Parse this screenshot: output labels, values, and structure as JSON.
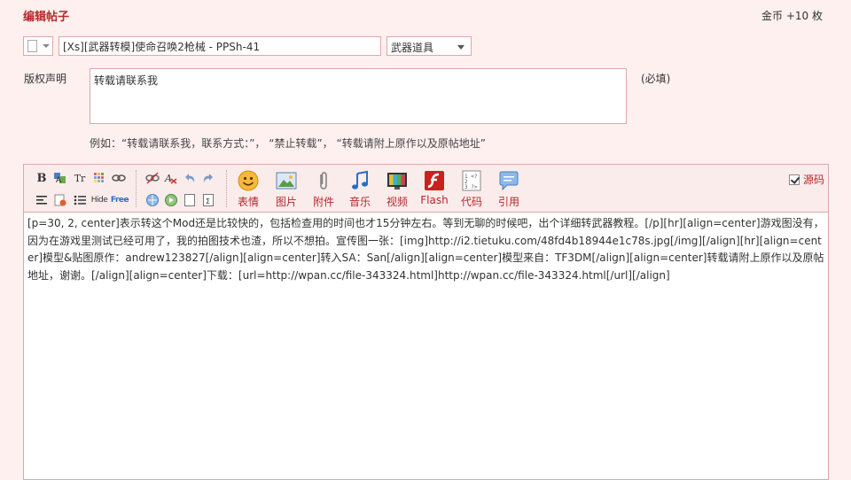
{
  "page": {
    "title": "编辑帖子",
    "reward": "金币 +10 枚"
  },
  "post": {
    "title_value": "[Xs][武器转模]使命召唤2枪械 - PPSh-41",
    "category": "武器道具"
  },
  "copyright": {
    "label": "版权声明",
    "value": "转载请联系我",
    "required_note": "(必填)",
    "example_hint": "例如：“转载请联系我，联系方式：”， “禁止转载”， “转载请附上原作以及原帖地址”"
  },
  "toolbar": {
    "big_buttons": [
      {
        "label": "表情",
        "icon": "smiley-icon"
      },
      {
        "label": "图片",
        "icon": "image-icon"
      },
      {
        "label": "附件",
        "icon": "paperclip-icon"
      },
      {
        "label": "音乐",
        "icon": "music-note-icon"
      },
      {
        "label": "视频",
        "icon": "video-icon"
      },
      {
        "label": "Flash",
        "icon": "flash-icon"
      },
      {
        "label": "代码",
        "icon": "code-icon"
      },
      {
        "label": "引用",
        "icon": "quote-icon"
      }
    ],
    "small_labels": {
      "bold": "B",
      "fontsize": "Tr",
      "hide": "Hide",
      "free": "Free"
    },
    "source_label": "源码",
    "source_checked": true
  },
  "editor": {
    "content": "[p=30, 2, center]表示转这个Mod还是比较快的，包括检查用的时间也才15分钟左右。等到无聊的时候吧，出个详细转武器教程。[/p][hr][align=center]游戏图没有，因为在游戏里测试已经可用了，我的拍图技术也渣，所以不想拍。宣传图一张：[img]http://i2.tietuku.com/48fd4b18944e1c78s.jpg[/img][/align][hr][align=center]模型&贴图原作：andrew123827[/align][align=center]转入SA：San[/align][align=center]模型来自：TF3DM[/align][align=center]转载请附上原作以及原帖地址，谢谢。[/align][align=center]下载：[url=http://wpan.cc/file-343324.html]http://wpan.cc/file-343324.html[/url][/align]"
  }
}
